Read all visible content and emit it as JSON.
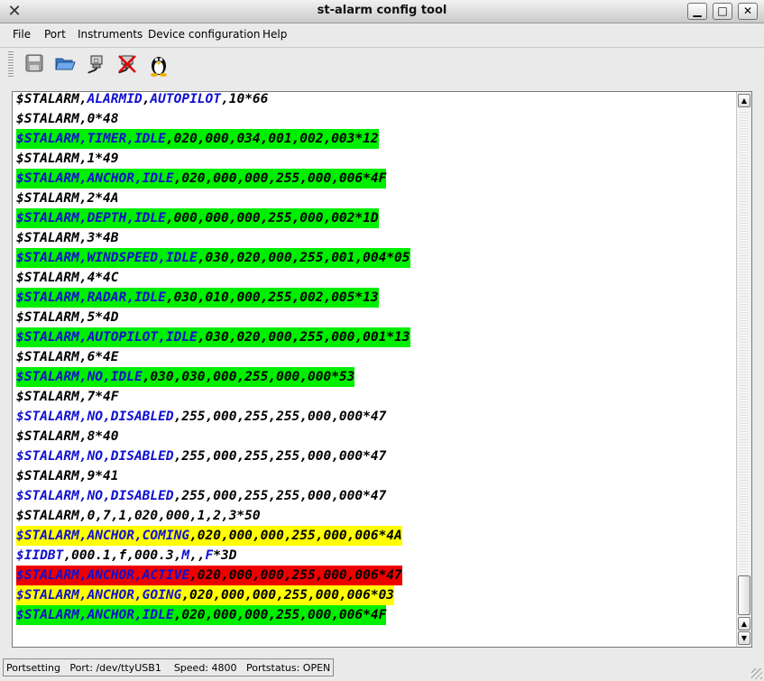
{
  "window": {
    "title": "st-alarm config tool",
    "app_icon": "x-icon"
  },
  "menu": [
    "File",
    "Port",
    "Instruments",
    "Device configuration",
    "Help"
  ],
  "toolbar": [
    "save-icon",
    "open-folder-icon",
    "connect-icon",
    "disconnect-icon",
    "tux-icon"
  ],
  "log_lines": [
    {
      "bg": "none",
      "segments": [
        [
          "k",
          "$STALARM,"
        ],
        [
          "b",
          "ALARMID"
        ],
        [
          "k",
          ","
        ],
        [
          "b",
          "AUTOPILOT"
        ],
        [
          "k",
          ",10*66"
        ]
      ]
    },
    {
      "bg": "none",
      "segments": [
        [
          "k",
          "$STALARM,0*48"
        ]
      ]
    },
    {
      "bg": "green",
      "segments": [
        [
          "b",
          "$STALARM,TIMER,IDLE"
        ],
        [
          "k",
          ",020,000,034,001,002,003*12"
        ]
      ]
    },
    {
      "bg": "none",
      "segments": [
        [
          "k",
          "$STALARM,1*49"
        ]
      ]
    },
    {
      "bg": "green",
      "segments": [
        [
          "b",
          "$STALARM,ANCHOR,IDLE"
        ],
        [
          "k",
          ",020,000,000,255,000,006*4F"
        ]
      ]
    },
    {
      "bg": "none",
      "segments": [
        [
          "k",
          "$STALARM,2*4A"
        ]
      ]
    },
    {
      "bg": "green",
      "segments": [
        [
          "b",
          "$STALARM,DEPTH,IDLE"
        ],
        [
          "k",
          ",000,000,000,255,000,002*1D"
        ]
      ]
    },
    {
      "bg": "none",
      "segments": [
        [
          "k",
          "$STALARM,3*4B"
        ]
      ]
    },
    {
      "bg": "green",
      "segments": [
        [
          "b",
          "$STALARM,WINDSPEED,IDLE"
        ],
        [
          "k",
          ",030,020,000,255,001,004*05"
        ]
      ]
    },
    {
      "bg": "none",
      "segments": [
        [
          "k",
          "$STALARM,4*4C"
        ]
      ]
    },
    {
      "bg": "green",
      "segments": [
        [
          "b",
          "$STALARM,RADAR,IDLE"
        ],
        [
          "k",
          ",030,010,000,255,002,005*13"
        ]
      ]
    },
    {
      "bg": "none",
      "segments": [
        [
          "k",
          "$STALARM,5*4D"
        ]
      ]
    },
    {
      "bg": "green",
      "segments": [
        [
          "b",
          "$STALARM,AUTOPILOT,IDLE"
        ],
        [
          "k",
          ",030,020,000,255,000,001*13"
        ]
      ]
    },
    {
      "bg": "none",
      "segments": [
        [
          "k",
          "$STALARM,6*4E"
        ]
      ]
    },
    {
      "bg": "green",
      "segments": [
        [
          "b",
          "$STALARM,NO,IDLE"
        ],
        [
          "k",
          ",030,030,000,255,000,000*53"
        ]
      ]
    },
    {
      "bg": "none",
      "segments": [
        [
          "k",
          "$STALARM,7*4F"
        ]
      ]
    },
    {
      "bg": "none",
      "segments": [
        [
          "b",
          "$STALARM,NO,DISABLED"
        ],
        [
          "k",
          ",255,000,255,255,000,000*47"
        ]
      ]
    },
    {
      "bg": "none",
      "segments": [
        [
          "k",
          "$STALARM,8*40"
        ]
      ]
    },
    {
      "bg": "none",
      "segments": [
        [
          "b",
          "$STALARM,NO,DISABLED"
        ],
        [
          "k",
          ",255,000,255,255,000,000*47"
        ]
      ]
    },
    {
      "bg": "none",
      "segments": [
        [
          "k",
          "$STALARM,9*41"
        ]
      ]
    },
    {
      "bg": "none",
      "segments": [
        [
          "b",
          "$STALARM,NO,DISABLED"
        ],
        [
          "k",
          ",255,000,255,255,000,000*47"
        ]
      ]
    },
    {
      "bg": "none",
      "segments": [
        [
          "k",
          "$STALARM,0,7,1,020,000,1,2,3*50"
        ]
      ]
    },
    {
      "bg": "yellow",
      "segments": [
        [
          "b",
          "$STALARM,ANCHOR,COMING"
        ],
        [
          "k",
          ",020,000,000,255,000,006*4A"
        ]
      ]
    },
    {
      "bg": "none",
      "segments": [
        [
          "b",
          "$IIDBT"
        ],
        [
          "k",
          ",000.1,f,000.3,"
        ],
        [
          "b",
          "M"
        ],
        [
          "k",
          ",,"
        ],
        [
          "b",
          "F"
        ],
        [
          "k",
          "*3D"
        ]
      ]
    },
    {
      "bg": "red",
      "segments": [
        [
          "b",
          "$STALARM,ANCHOR,ACTIVE"
        ],
        [
          "k",
          ",020,000,000,255,000,006*47"
        ]
      ]
    },
    {
      "bg": "yellow",
      "segments": [
        [
          "b",
          "$STALARM,ANCHOR,GOING"
        ],
        [
          "k",
          ",020,000,000,255,000,006*03"
        ]
      ]
    },
    {
      "bg": "green",
      "segments": [
        [
          "b",
          "$STALARM,ANCHOR,IDLE"
        ],
        [
          "k",
          ",020,000,000,255,000,006*4F"
        ]
      ]
    }
  ],
  "colors": {
    "green": "#00ee00",
    "yellow": "#ffff00",
    "red": "#ee0000",
    "blue_text": "#1010d0"
  },
  "status": {
    "text": "Portsetting   Port: /dev/ttyUSB1    Speed: 4800   Portstatus: OPEN"
  }
}
